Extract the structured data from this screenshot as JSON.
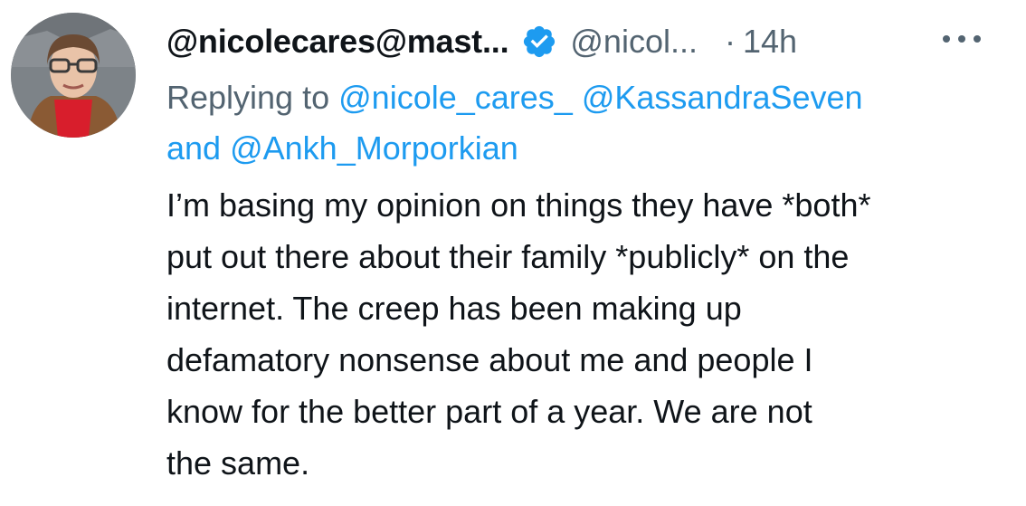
{
  "tweet": {
    "display_name": "@nicolecares@mast...",
    "handle": "@nicol...",
    "separator": "·",
    "time": "14h",
    "verified_color": "#1d9bf0",
    "icons": {
      "verified": "verified-badge-icon",
      "more": "more-options-icon"
    },
    "reply": {
      "prefix": "Replying to",
      "mention_1": "@nicole_cares_",
      "mention_2": "@KassandraSeven",
      "conjunction": "and",
      "mention_3": "@Ankh_Morporkian"
    },
    "body_lines": [
      "I’m basing my opinion on things they have *both*",
      "put out there about their family *publicly* on the",
      "internet. The creep has been making up",
      "defamatory nonsense about me and people I",
      "know for the better part of a year. We are not",
      "the same."
    ]
  }
}
